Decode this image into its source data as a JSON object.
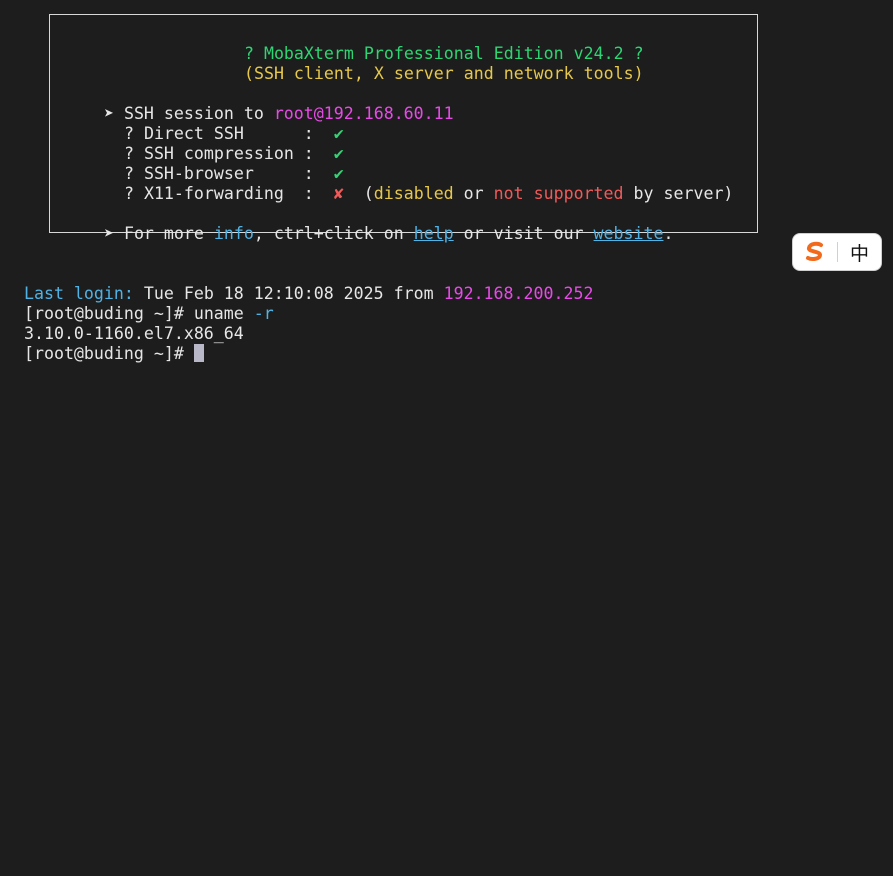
{
  "banner": {
    "title_line": "? MobaXterm Professional Edition v24.2 ?",
    "subtitle_line": "(SSH client, X server and network tools)",
    "session_prefix": "➤ SSH session to ",
    "session_target": "root@192.168.60.11",
    "features": [
      {
        "label": "? Direct SSH      :  ",
        "mark": "✔"
      },
      {
        "label": "? SSH compression :  ",
        "mark": "✔"
      },
      {
        "label": "? SSH-browser     :  ",
        "mark": "✔"
      }
    ],
    "x11": {
      "label": "? X11-forwarding  :  ",
      "mark": "✘",
      "paren_open": "  (",
      "disabled": "disabled",
      "or": " or ",
      "not_supported": "not supported",
      "by_server": " by server)"
    },
    "more": {
      "prefix": "➤ For more ",
      "info": "info",
      "mid1": ", ctrl+click on ",
      "help": "help",
      "mid2": " or visit our ",
      "website": "website",
      "end": "."
    }
  },
  "terminal": {
    "last_login_label": "Last login:",
    "last_login_date": " Tue Feb 18 12:10:08 2025 from ",
    "last_login_ip": "192.168.200.252",
    "prompt1": "[root@buding ~]# ",
    "command": "uname",
    "command_arg": " -r",
    "output": "3.10.0-1160.el7.x86_64",
    "prompt2": "[root@buding ~]# "
  },
  "ime": {
    "language": "中"
  },
  "colors": {
    "background": "#1d1d1d",
    "green": "#2ed573",
    "yellow": "#e6c84b",
    "magenta": "#e84ae8",
    "red": "#ef5a5a",
    "cyan": "#4fb3e6",
    "ime_logo": "#f26b1d"
  }
}
